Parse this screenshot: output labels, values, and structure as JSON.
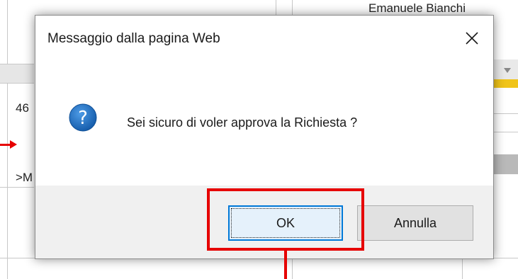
{
  "background": {
    "top_name_text": "Emanuele Bianchi",
    "left_fragment_1": "46",
    "left_fragment_2": ">M"
  },
  "dialog": {
    "title": "Messaggio dalla pagina Web",
    "close_glyph": "✕",
    "icon_glyph": "?",
    "message": "Sei sicuro di voler approva la Richiesta ?",
    "ok_label": "OK",
    "cancel_label": "Annulla"
  },
  "colors": {
    "annotation_red": "#e60000",
    "question_icon_blue": "#1e6fc7",
    "ok_focus_blue": "#0078d7",
    "footer_gray": "#f0f0f0"
  }
}
